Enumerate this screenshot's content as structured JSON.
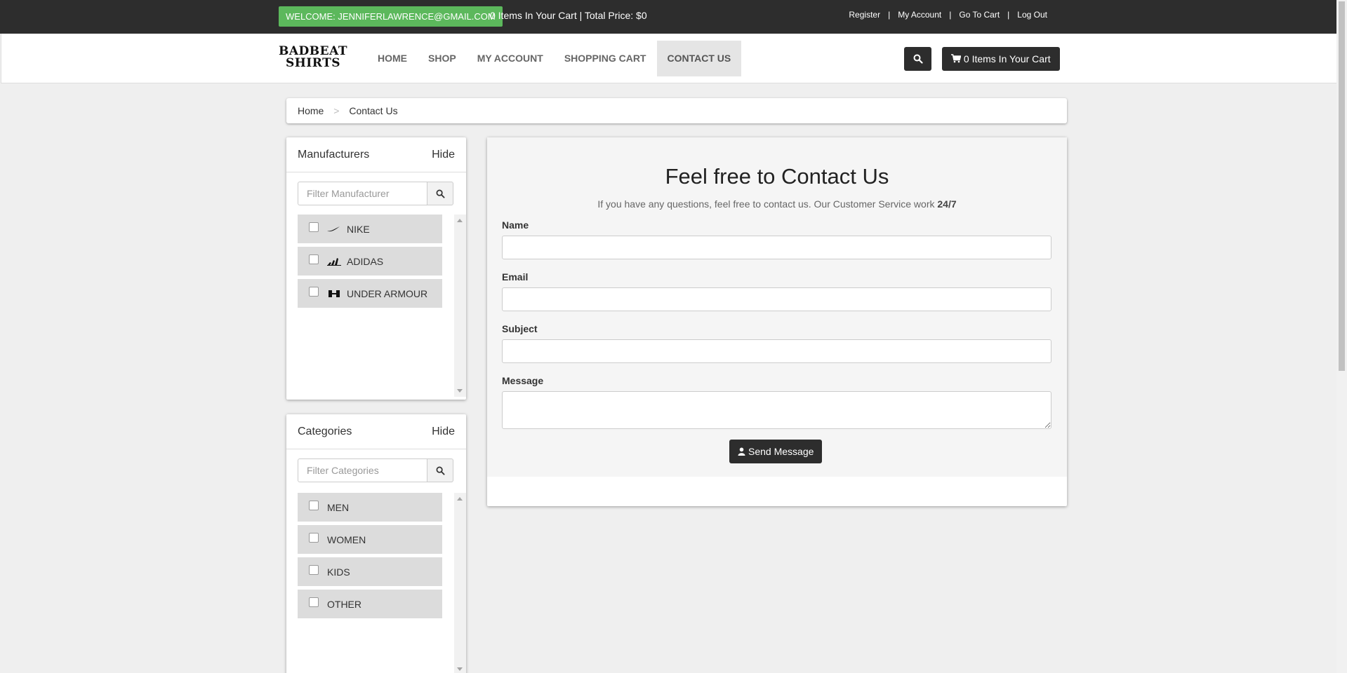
{
  "topbar": {
    "welcome": "WELCOME: JENNIFERLAWRENCE@GMAIL.COM",
    "cart_summary": "0 Items In Your Cart | Total Price: $0",
    "links": [
      "Register",
      "My Account",
      "Go To Cart",
      "Log Out"
    ]
  },
  "navbar": {
    "logo_line1": "BADBEAT",
    "logo_line2": "SHIRTS",
    "items": [
      "HOME",
      "SHOP",
      "MY ACCOUNT",
      "SHOPPING CART",
      "CONTACT US"
    ],
    "active_item": "CONTACT US",
    "cart_button": "0 Items In Your Cart",
    "icons": {
      "search": "search-icon",
      "cart": "shopping-cart-icon"
    }
  },
  "breadcrumb": {
    "home": "Home",
    "separator": ">",
    "current": "Contact Us"
  },
  "manufacturers": {
    "title": "Manufacturers",
    "hide_label": "Hide",
    "filter_placeholder": "Filter Manufacturer",
    "items": [
      "NIKE",
      "ADIDAS",
      "UNDER ARMOUR"
    ]
  },
  "categories": {
    "title": "Categories",
    "hide_label": "Hide",
    "filter_placeholder": "Filter Categories",
    "items": [
      "MEN",
      "WOMEN",
      "KIDS",
      "OTHER"
    ]
  },
  "contact": {
    "heading": "Feel free to Contact Us",
    "subtitle": "If you have any questions, feel free to contact us. Our Customer Service work",
    "subtitle_bold": "24/7",
    "fields": {
      "name_label": "Name",
      "email_label": "Email",
      "subject_label": "Subject",
      "message_label": "Message"
    },
    "send_label": "Send Message"
  }
}
